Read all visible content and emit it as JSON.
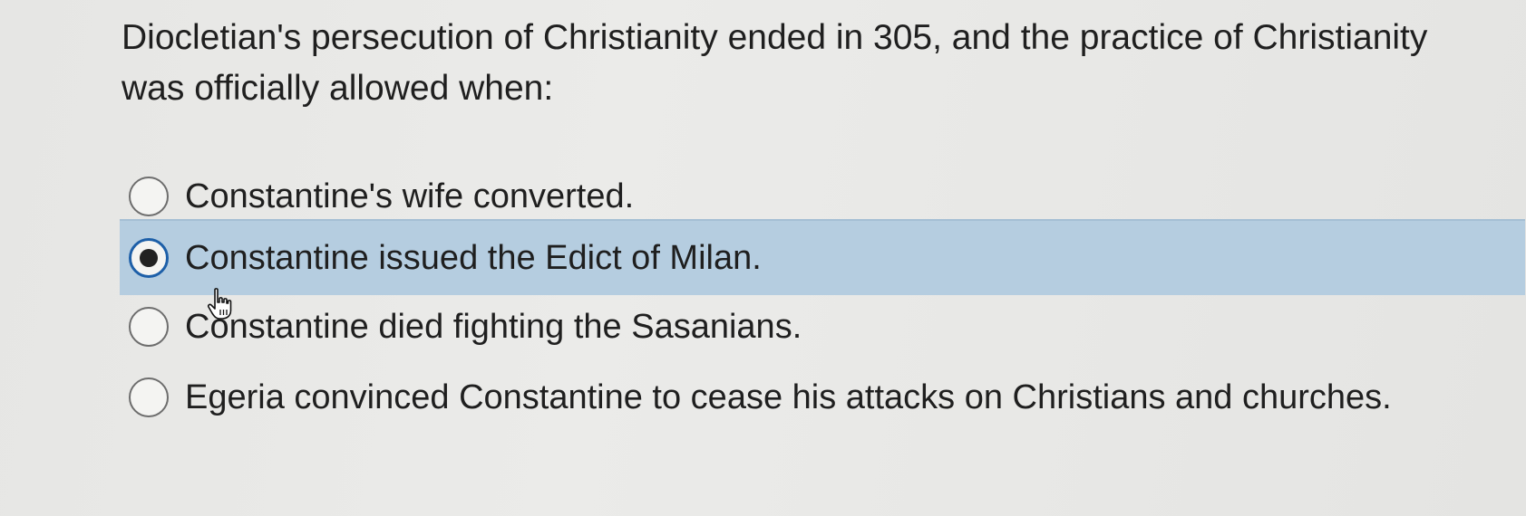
{
  "question": {
    "text": "Diocletian's persecution of Christianity ended in 305, and the practice of Christianity was officially allowed when:"
  },
  "options": [
    {
      "label": "Constantine's wife converted.",
      "selected": false
    },
    {
      "label": "Constantine issued the Edict of Milan.",
      "selected": true
    },
    {
      "label": "Constantine died fighting the Sasanians.",
      "selected": false
    },
    {
      "label": "Egeria convinced Constantine to cease his attacks on Christians and churches.",
      "selected": false
    }
  ],
  "colors": {
    "selected_background": "#b5cde0",
    "radio_checked_ring": "#1d5fa8"
  },
  "icons": {
    "cursor": "hand-pointer-icon"
  }
}
